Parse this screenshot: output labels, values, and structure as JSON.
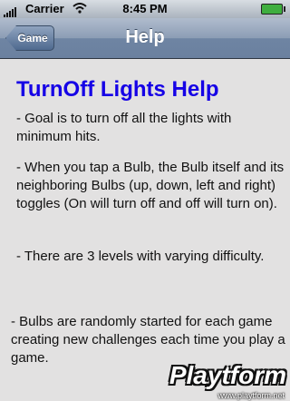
{
  "status_bar": {
    "carrier": "Carrier",
    "time": "8:45 PM"
  },
  "nav": {
    "back_label": "Game",
    "title": "Help"
  },
  "help": {
    "title": "TurnOff Lights Help",
    "paragraphs": [
      "- Goal is to turn off all the lights with minimum hits.",
      "- When you tap a Bulb, the Bulb itself and its neighboring Bulbs (up, down, left and right) toggles (On will turn off and off will turn on).",
      "- There are 3 levels with varying difficulty.",
      "- Bulbs are randomly started for each game creating new challenges each time you play a game."
    ]
  },
  "watermark": {
    "logo": "Playtform",
    "url": "www.playtform.net"
  },
  "colors": {
    "title_blue": "#1500e6",
    "nav_bar": "#8c9db5",
    "content_bg": "#e2e1e1"
  }
}
